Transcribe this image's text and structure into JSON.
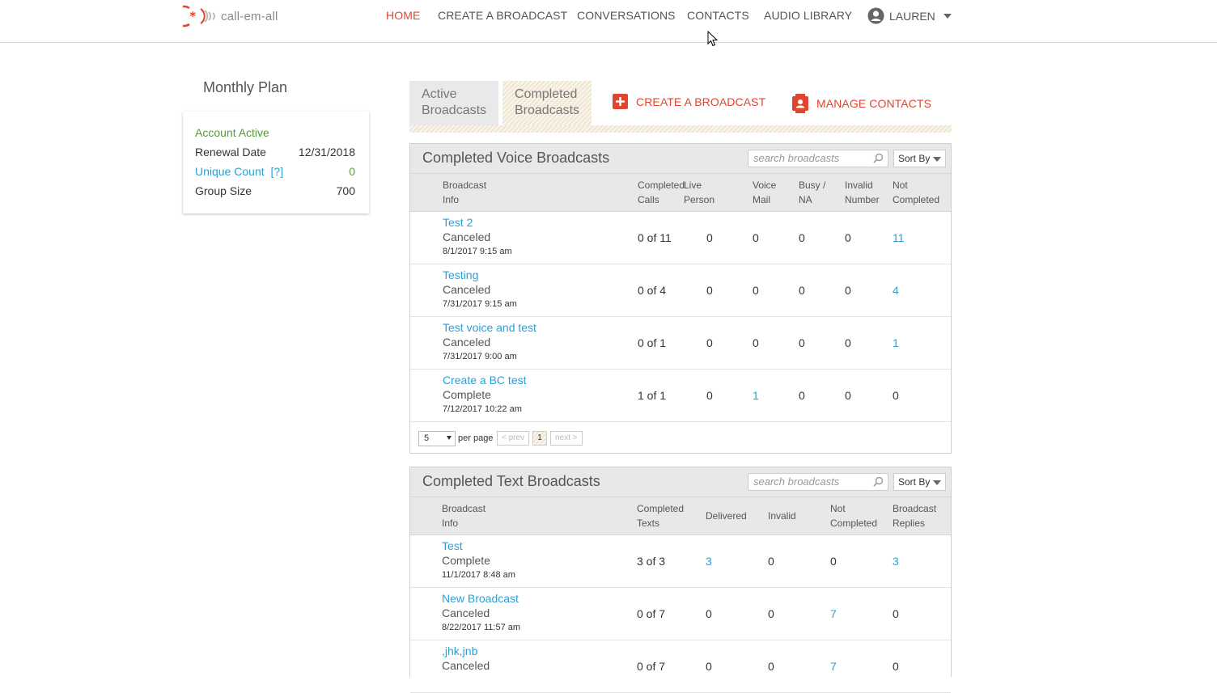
{
  "brand": {
    "name": "call-em-all"
  },
  "nav": {
    "home": "HOME",
    "create_broadcast": "CREATE A BROADCAST",
    "conversations": "CONVERSATIONS",
    "contacts": "CONTACTS",
    "audio_library": "AUDIO LIBRARY",
    "user": "LAUREN"
  },
  "plan": {
    "title": "Monthly Plan",
    "status": "Account Active",
    "renewal_label": "Renewal Date",
    "renewal_value": "12/31/2018",
    "unique_label": "Unique Count",
    "unique_help": "[?]",
    "unique_value": "0",
    "group_label": "Group Size",
    "group_value": "700"
  },
  "tabs": {
    "active_line1": "Active",
    "active_line2": "Broadcasts",
    "completed_line1": "Completed",
    "completed_line2": "Broadcasts"
  },
  "actions": {
    "create": "CREATE A BROADCAST",
    "manage": "MANAGE CONTACTS"
  },
  "voice": {
    "title": "Completed Voice Broadcasts",
    "search_placeholder": "search broadcasts",
    "sort": "Sort By",
    "cols": [
      [
        "Broadcast",
        "Info"
      ],
      [
        "Completed",
        "Calls"
      ],
      [
        "Live",
        "Person"
      ],
      [
        "Voice",
        "Mail"
      ],
      [
        "Busy /",
        "NA"
      ],
      [
        "Invalid",
        "Number"
      ],
      [
        "Not",
        "Completed"
      ]
    ],
    "rows": [
      {
        "name": "Test 2",
        "status": "Canceled",
        "date": "8/1/2017 9:15 am",
        "completed": "0 of 11",
        "live": "0",
        "vm": "0",
        "busy": "0",
        "invalid": "0",
        "not": "11"
      },
      {
        "name": "Testing",
        "status": "Canceled",
        "date": "7/31/2017 9:15 am",
        "completed": "0 of 4",
        "live": "0",
        "vm": "0",
        "busy": "0",
        "invalid": "0",
        "not": "4"
      },
      {
        "name": "Test voice and test",
        "status": "Canceled",
        "date": "7/31/2017 9:00 am",
        "completed": "0 of 1",
        "live": "0",
        "vm": "0",
        "busy": "0",
        "invalid": "0",
        "not": "1"
      },
      {
        "name": "Create a BC test",
        "status": "Complete",
        "date": "7/12/2017 10:22 am",
        "completed": "1 of 1",
        "live": "0",
        "vm": "1",
        "busy": "0",
        "invalid": "0",
        "not": "0"
      }
    ],
    "pager": {
      "per_page_value": "5",
      "per_page_label": "per page",
      "prev": "< prev",
      "current": "1",
      "next": "next >"
    }
  },
  "text": {
    "title": "Completed Text Broadcasts",
    "search_placeholder": "search broadcasts",
    "sort": "Sort By",
    "cols": [
      [
        "Broadcast",
        "Info"
      ],
      [
        "Completed",
        "Texts"
      ],
      [
        "Delivered",
        ""
      ],
      [
        "Invalid",
        ""
      ],
      [
        "Not",
        "Completed"
      ],
      [
        "Broadcast",
        "Replies"
      ]
    ],
    "rows": [
      {
        "name": "Test",
        "status": "Complete",
        "date": "11/1/2017 8:48 am",
        "completed": "3 of 3",
        "delivered": "3",
        "invalid": "0",
        "not": "0",
        "replies": "3"
      },
      {
        "name": "New Broadcast",
        "status": "Canceled",
        "date": "8/22/2017 11:57 am",
        "completed": "0 of 7",
        "delivered": "0",
        "invalid": "0",
        "not": "7",
        "replies": "0"
      },
      {
        "name": ",jhk,jnb",
        "status": "Canceled",
        "date": "",
        "completed": "0 of 7",
        "delivered": "0",
        "invalid": "0",
        "not": "7",
        "replies": "0"
      }
    ]
  },
  "colors": {
    "accent": "#e0462f",
    "link": "#2b9fd6",
    "active_green": "#5a9a3a"
  }
}
